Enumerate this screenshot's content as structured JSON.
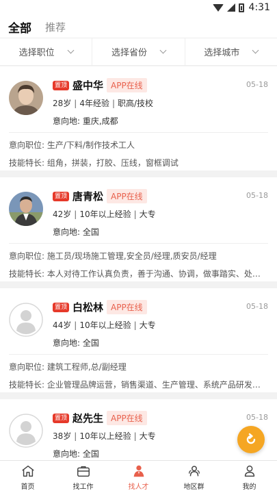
{
  "status_bar": {
    "time": "4:31"
  },
  "tabs": {
    "all": "全部",
    "recommend": "推荐"
  },
  "filters": [
    {
      "label": "选择职位"
    },
    {
      "label": "选择省份"
    },
    {
      "label": "选择城市"
    }
  ],
  "cards": [
    {
      "badge": "置顶",
      "name": "盛中华",
      "status": "APP在线",
      "date": "05-18",
      "age": "28岁",
      "experience": "4年经验",
      "education": "职高/技校",
      "location": "意向地: 重庆,成都",
      "position": "意向职位: 生产/下料/制作技术工人",
      "skills": "技能特长: 组角，拼装，打胶、压线，窗框调试"
    },
    {
      "badge": "置顶",
      "name": "唐青松",
      "status": "APP在线",
      "date": "05-18",
      "age": "42岁",
      "experience": "10年以上经验",
      "education": "大专",
      "location": "意向地: 全国",
      "position": "意向职位: 施工员/现场施工管理,安全员/经理,质安员/经理",
      "skills": "技能特长: 本人对待工作认真负责，善于沟通、协调，做事踏实、处事..."
    },
    {
      "badge": "置顶",
      "name": "白松林",
      "status": "APP在线",
      "date": "05-18",
      "age": "44岁",
      "experience": "10年以上经验",
      "education": "大专",
      "location": "意向地: 全国",
      "position": "意向职位: 建筑工程师,总/副经理",
      "skills": "技能特长: 企业管理品牌运营，销售渠道、生产管理、系统产品研发、..."
    },
    {
      "badge": "置顶",
      "name": "赵先生",
      "status": "APP在线",
      "date": "05-18",
      "age": "38岁",
      "experience": "10年以上经验",
      "education": "大专",
      "location": "意向地: 全国"
    }
  ],
  "nav": [
    {
      "label": "首页",
      "icon": "home-icon"
    },
    {
      "label": "找工作",
      "icon": "briefcase-icon"
    },
    {
      "label": "找人才",
      "icon": "person-icon"
    },
    {
      "label": "地区群",
      "icon": "group-icon"
    },
    {
      "label": "我的",
      "icon": "user-icon"
    }
  ],
  "colors": {
    "accent": "#e8604c",
    "badge": "#e6392a",
    "fab": "#f5a623"
  }
}
